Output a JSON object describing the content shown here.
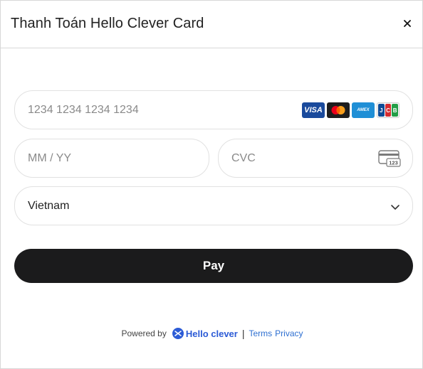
{
  "modal": {
    "title": "Thanh Toán Hello Clever Card",
    "close_label": "×"
  },
  "form": {
    "card_number_placeholder": "1234 1234 1234 1234",
    "expiry_placeholder": "MM / YY",
    "cvc_placeholder": "CVC",
    "country_value": "Vietnam",
    "card_brands": [
      {
        "name": "visa",
        "label": "VISA"
      },
      {
        "name": "mastercard",
        "label": ""
      },
      {
        "name": "amex",
        "label": "AMEX"
      },
      {
        "name": "jcb",
        "label": "JCB",
        "letters": [
          "J",
          "C",
          "B"
        ]
      }
    ],
    "cvc_icon_text": "123",
    "pay_label": "Pay"
  },
  "footer": {
    "powered_by": "Powered by",
    "brand_name": "Hello clever",
    "separator": "|",
    "terms_label": "Terms",
    "privacy_label": "Privacy"
  },
  "colors": {
    "pay_button": "#1b1b1c",
    "brand_blue": "#2c5bd6",
    "link_blue": "#2d6fd1"
  }
}
